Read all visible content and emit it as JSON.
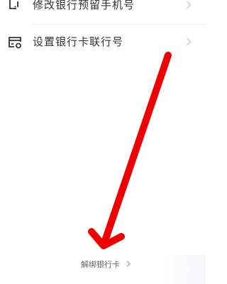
{
  "menu": {
    "items": [
      {
        "label": "修改银行预留手机号",
        "icon": "phone-edit-icon"
      },
      {
        "label": "设置银行卡联行号",
        "icon": "bank-card-icon"
      }
    ]
  },
  "footer": {
    "unbind_label": "解绑银行卡"
  },
  "annotation": {
    "arrow_color": "#ee0000"
  }
}
